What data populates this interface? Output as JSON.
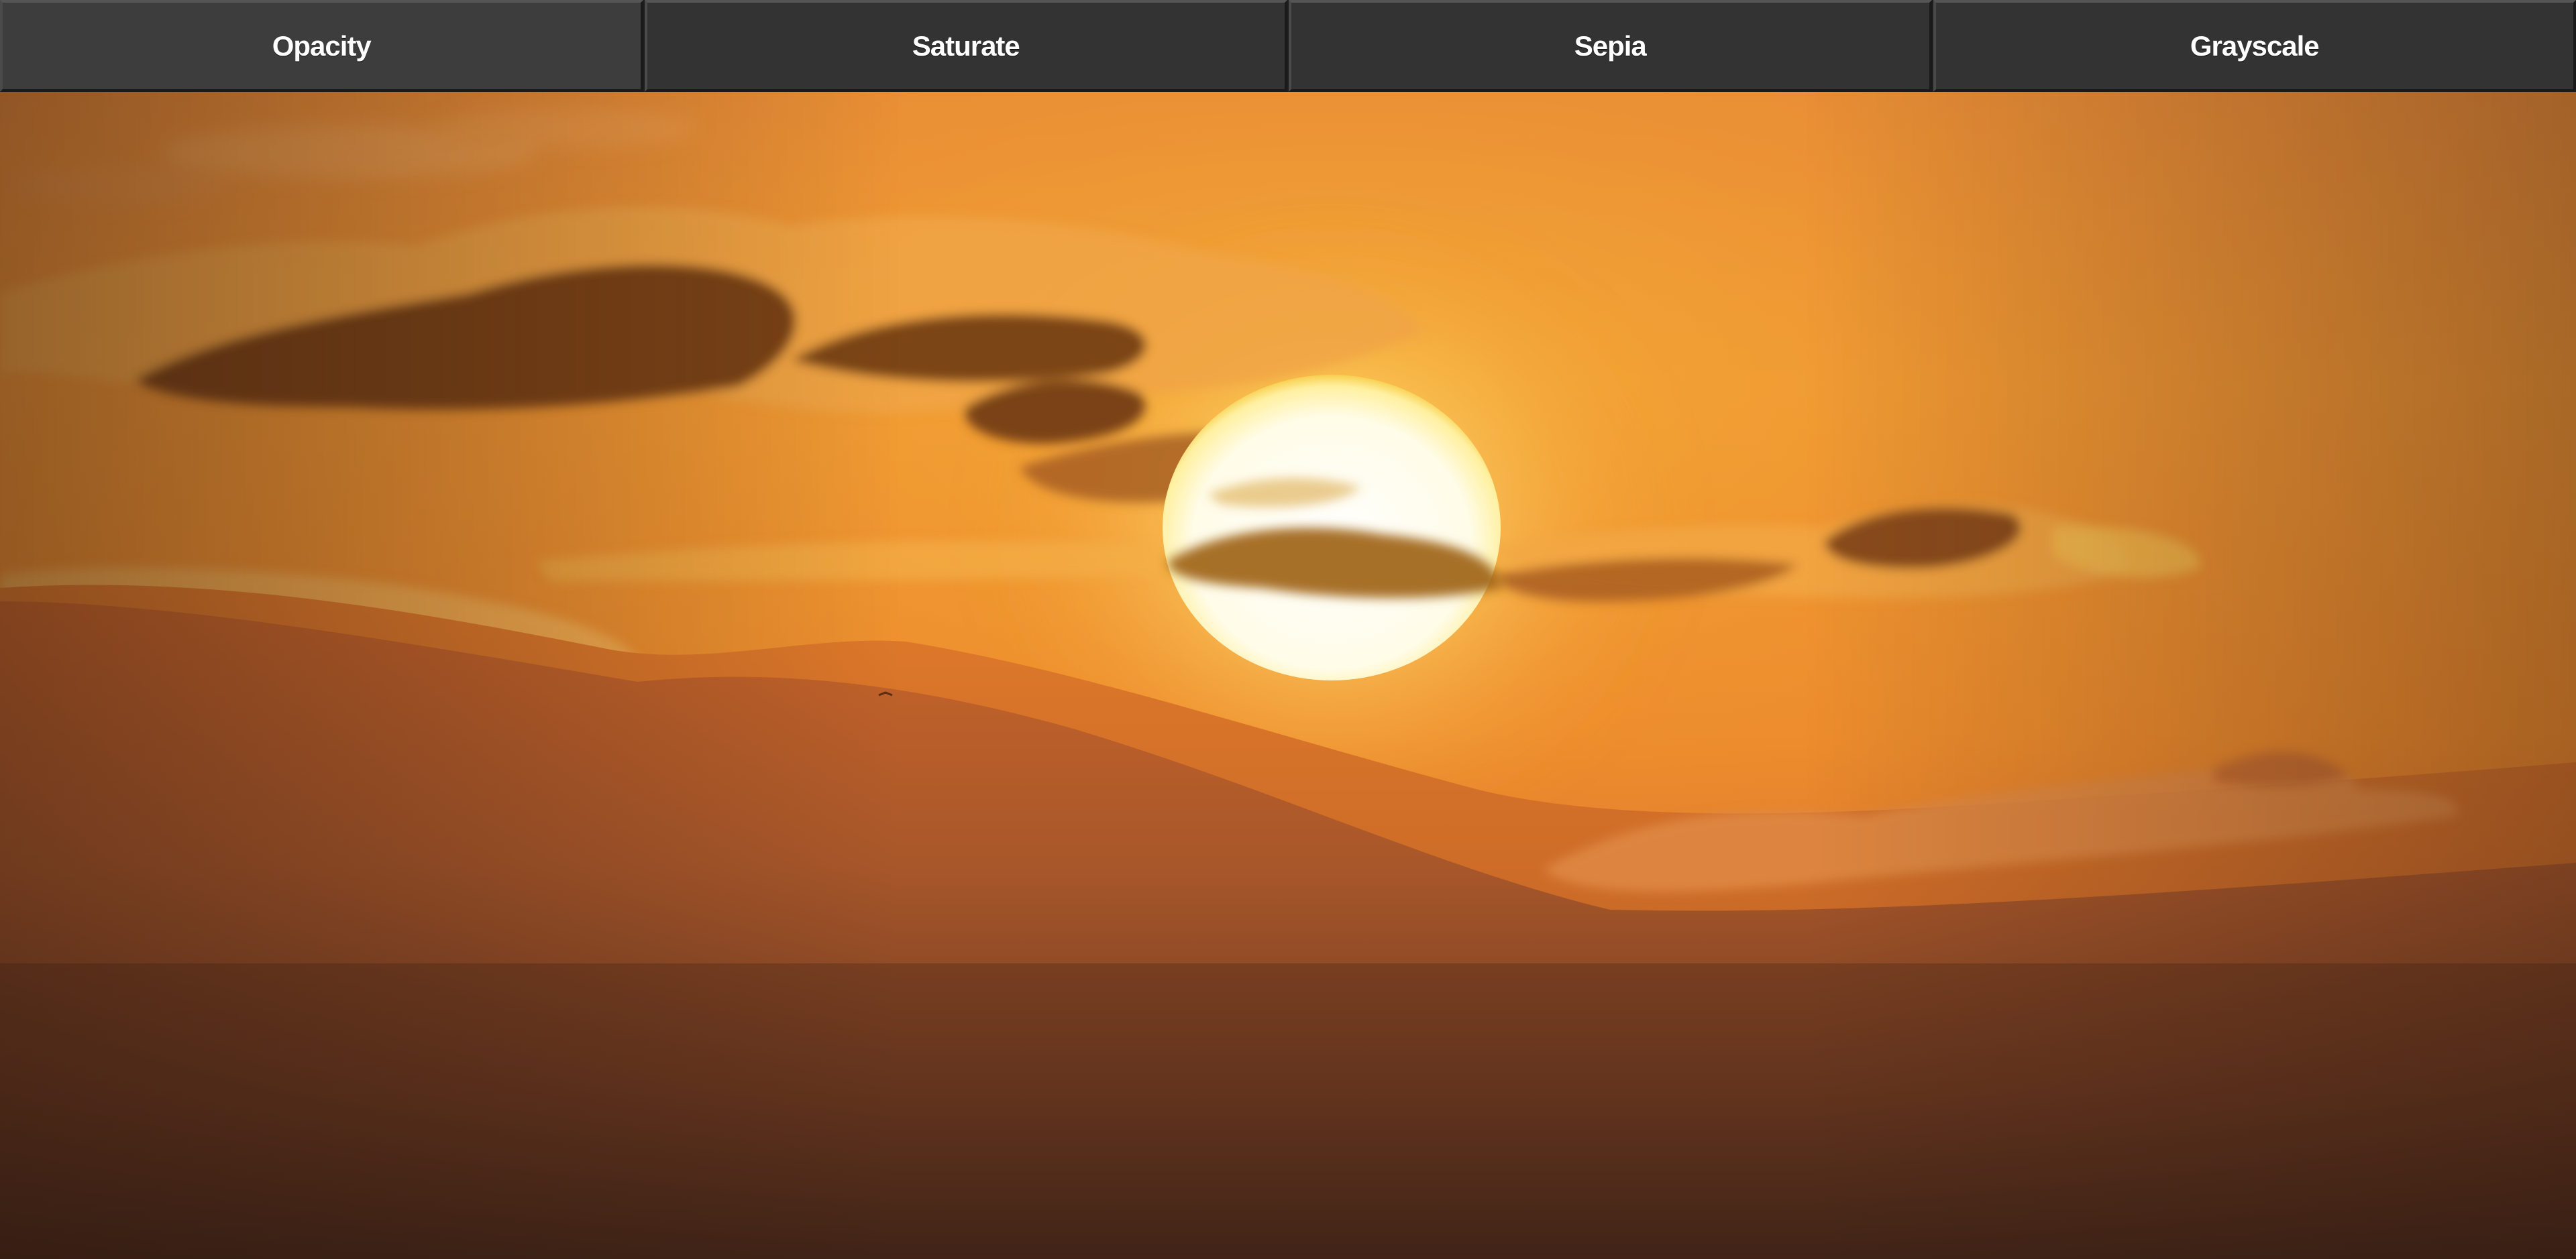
{
  "toolbar": {
    "buttons": [
      {
        "label": "Opacity"
      },
      {
        "label": "Saturate"
      },
      {
        "label": "Sepia"
      },
      {
        "label": "Grayscale"
      }
    ]
  },
  "photo": {
    "subject": "sunset over hills with clouds",
    "palette": {
      "sky_top": "#e8913a",
      "sky_mid": "#f2952e",
      "haze": "#e67a28",
      "ground_dark": "#3c2318",
      "cloud_dark": "#7a3f14",
      "sun_core": "#fffdf0",
      "sun_glow": "#fff3b0"
    }
  }
}
